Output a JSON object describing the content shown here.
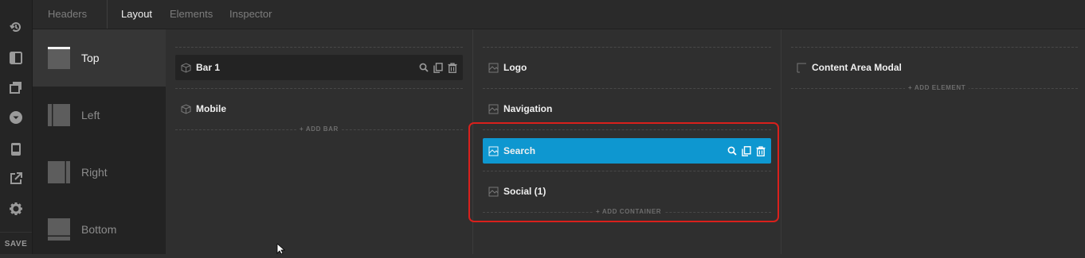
{
  "rail": {
    "items": [
      "history-icon",
      "sidebar-panel-icon",
      "copy-stack-icon",
      "chevron-down-circle-icon",
      "device-mobile-icon",
      "external-link-icon",
      "gear-icon"
    ],
    "save_label": "SAVE"
  },
  "tabs": [
    {
      "label": "Headers",
      "active": false
    },
    {
      "label": "Layout",
      "active": true
    },
    {
      "label": "Elements",
      "active": false
    },
    {
      "label": "Inspector",
      "active": false
    }
  ],
  "positions": [
    {
      "label": "Top",
      "active": true
    },
    {
      "label": "Left",
      "active": false
    },
    {
      "label": "Right",
      "active": false
    },
    {
      "label": "Bottom",
      "active": false
    }
  ],
  "bars_column": {
    "rows": [
      {
        "name": "Bar 1",
        "icon": "cube-icon",
        "selected": true
      },
      {
        "name": "Mobile",
        "icon": "cube-icon",
        "selected": false
      }
    ],
    "add_label": "ADD BAR"
  },
  "containers_column": {
    "rows": [
      {
        "name": "Logo",
        "icon": "container-icon"
      },
      {
        "name": "Navigation",
        "icon": "container-icon"
      },
      {
        "name": "Search",
        "icon": "container-icon",
        "selected": true
      },
      {
        "name": "Social (1)",
        "icon": "container-icon"
      }
    ],
    "add_label": "ADD CONTAINER"
  },
  "elements_column": {
    "rows": [
      {
        "name": "Content Area Modal",
        "icon": "element-icon"
      }
    ],
    "add_label": "ADD ELEMENT"
  },
  "colors": {
    "accent": "#0e97d0",
    "highlight_border": "#d9201c"
  }
}
